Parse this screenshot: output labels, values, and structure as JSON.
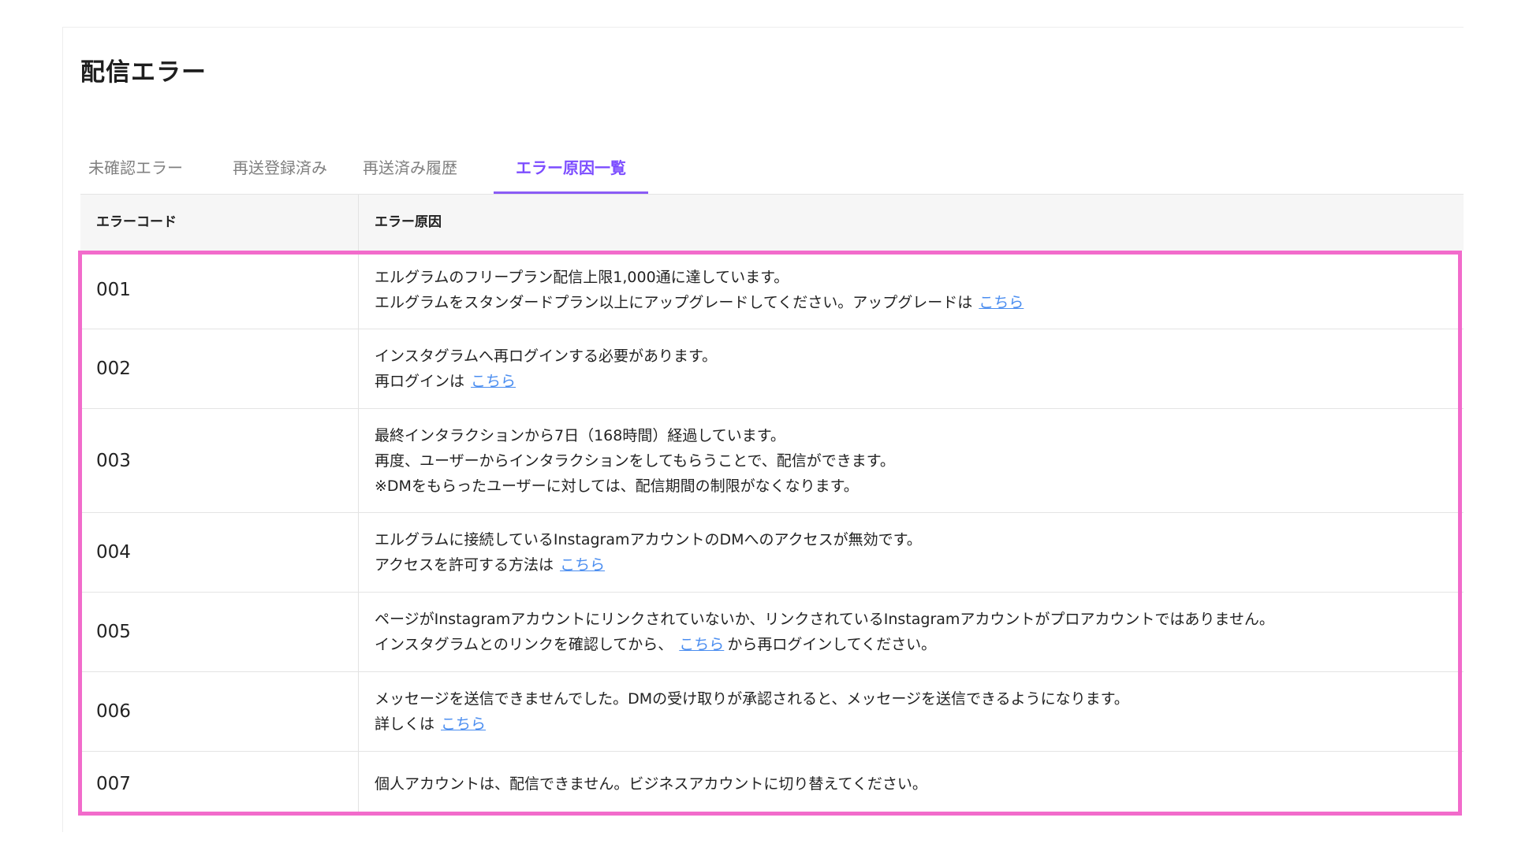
{
  "page_title": "配信エラー",
  "tabs": [
    {
      "label": "未確認エラー"
    },
    {
      "label": "再送登録済み"
    },
    {
      "label": "再送済み履歴"
    },
    {
      "label": "エラー原因一覧"
    }
  ],
  "table": {
    "headers": {
      "code": "エラーコード",
      "cause": "エラー原因"
    },
    "rows": [
      {
        "code": "001",
        "line1": "エルグラムのフリープラン配信上限1,000通に達しています。",
        "line2": "エルグラムをスタンダードプラン以上にアップグレードしてください。アップグレードは",
        "link": "こちら"
      },
      {
        "code": "002",
        "line1": "インスタグラムへ再ログインする必要があります。",
        "line2": "再ログインは",
        "link": "こちら"
      },
      {
        "code": "003",
        "line1": "最終インタラクションから7日（168時間）経過しています。",
        "line2": "再度、ユーザーからインタラクションをしてもらうことで、配信ができます。",
        "line3": "※DMをもらったユーザーに対しては、配信期間の制限がなくなります。"
      },
      {
        "code": "004",
        "line1": "エルグラムに接続しているInstagramアカウントのDMへのアクセスが無効です。",
        "line2": "アクセスを許可する方法は",
        "link": "こちら"
      },
      {
        "code": "005",
        "line1": "ページがInstagramアカウントにリンクされていないか、リンクされているInstagramアカウントがプロアカウントではありません。",
        "line2": "インスタグラムとのリンクを確認してから、",
        "link": "こちら",
        "line2_after": "から再ログインしてください。"
      },
      {
        "code": "006",
        "line1": "メッセージを送信できませんでした。DMの受け取りが承認されると、メッセージを送信できるようになります。",
        "line2": "詳しくは",
        "link": "こちら"
      },
      {
        "code": "007",
        "line1": "個人アカウントは、配信できません。ビジネスアカウントに切り替えてください。"
      }
    ]
  },
  "colors": {
    "accent": "#8a5cf5",
    "highlight": "#f26bcb",
    "link": "#4a8df0"
  }
}
